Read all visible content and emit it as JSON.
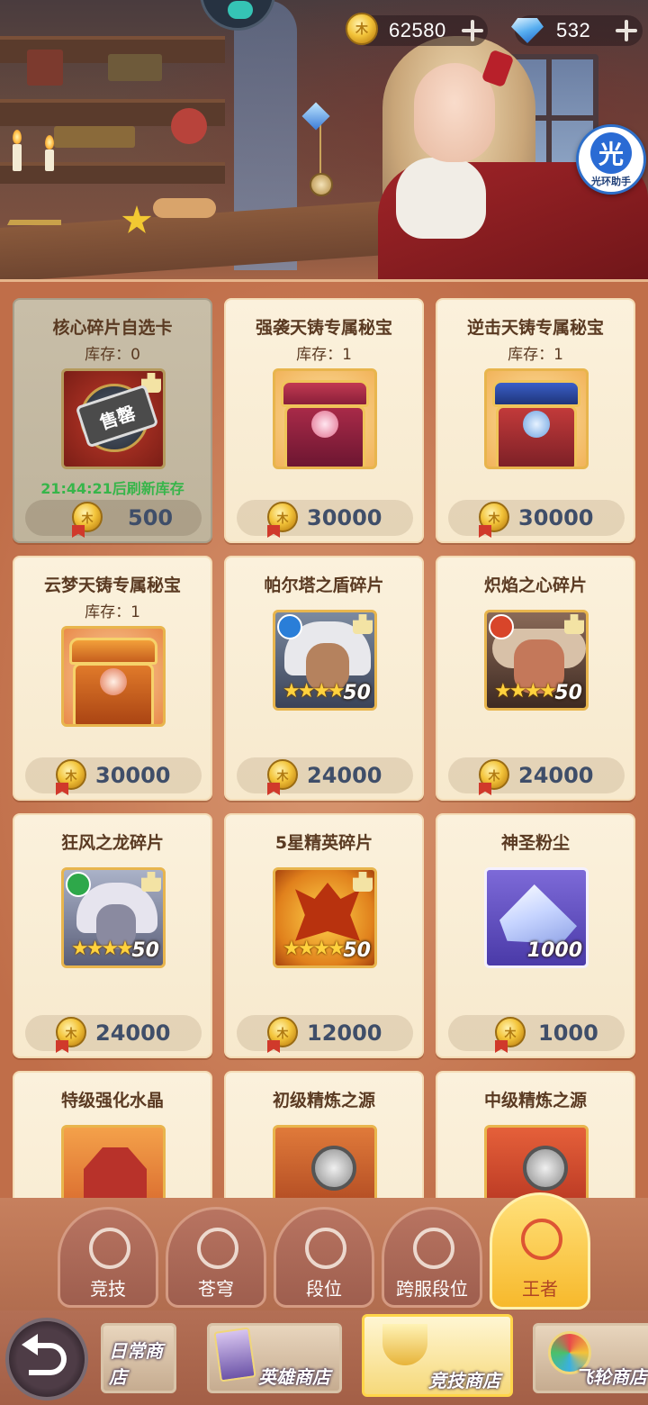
{
  "currency": {
    "gold": {
      "amount": "62580",
      "icon": "gold-coin-icon"
    },
    "diamond": {
      "amount": "532",
      "icon": "diamond-icon"
    }
  },
  "assistant": {
    "glyph": "光",
    "caption": "光环助手"
  },
  "shop_items": [
    {
      "name": "核心碎片自选卡",
      "stock": "库存：0",
      "price": "500",
      "sold_out": true,
      "sold_label": "售罄",
      "refresh": "21:44:21后刷新库存"
    },
    {
      "name": "强袭天铸专属秘宝",
      "stock": "库存：1",
      "price": "30000"
    },
    {
      "name": "逆击天铸专属秘宝",
      "stock": "库存：1",
      "price": "30000"
    },
    {
      "name": "云梦天铸专属秘宝",
      "stock": "库存：1",
      "price": "30000"
    },
    {
      "name": "帕尔塔之盾碎片",
      "price": "24000",
      "count": "50",
      "stars": "★★★★"
    },
    {
      "name": "炽焰之心碎片",
      "price": "24000",
      "count": "50",
      "stars": "★★★★"
    },
    {
      "name": "狂风之龙碎片",
      "price": "24000",
      "count": "50",
      "stars": "★★★★"
    },
    {
      "name": "5星精英碎片",
      "price": "12000",
      "count": "50",
      "stars": "★★★★"
    },
    {
      "name": "神圣粉尘",
      "price": "1000",
      "count": "1000"
    },
    {
      "name": "特级强化水晶"
    },
    {
      "name": "初级精炼之源"
    },
    {
      "name": "中级精炼之源"
    }
  ],
  "tier_tabs": [
    {
      "label": "竞技",
      "icon": "crossed-swords-icon"
    },
    {
      "label": "苍穹",
      "icon": "helmet-icon"
    },
    {
      "label": "段位",
      "icon": "rank-badge-icon"
    },
    {
      "label": "跨服段位",
      "icon": "cross-server-rank-icon"
    },
    {
      "label": "王者",
      "icon": "king-trophy-icon",
      "active": true
    }
  ],
  "store_tabs": [
    {
      "label": "日常商店"
    },
    {
      "label": "英雄商店"
    },
    {
      "label": "竞技商店",
      "active": true
    },
    {
      "label": "飞轮商店"
    }
  ],
  "colors": {
    "price_text": "#3f4e69",
    "refresh_text": "#37b54a",
    "card_bg": "#fbf1dc",
    "panel_bg": "#c97a55",
    "active_tab": "#f7b92c"
  }
}
